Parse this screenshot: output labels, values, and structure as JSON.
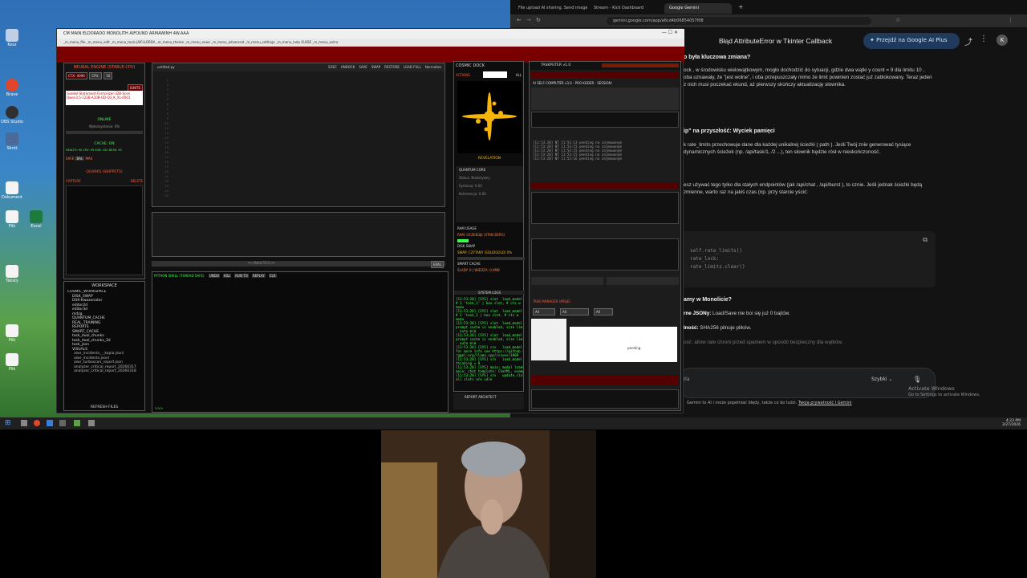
{
  "desktop": {
    "icons": [
      {
        "label": "Kosz",
        "color": "#bfcfe8"
      },
      {
        "label": "Brave",
        "color": "#e0462b"
      },
      {
        "label": "OBS Studio",
        "color": "#303030"
      },
      {
        "label": "Skrót",
        "color": "#4a6a9a"
      },
      {
        "label": "Dokument",
        "color": "#f4f4f4"
      },
      {
        "label": "Plik",
        "color": "#f4f4f4"
      },
      {
        "label": "Excel",
        "color": "#1d7a3e"
      },
      {
        "label": "Teksty",
        "color": "#f4f4f4"
      },
      {
        "label": "Plik",
        "color": "#f4f4f4"
      },
      {
        "label": "Plik",
        "color": "#f4f4f4"
      }
    ]
  },
  "chrome": {
    "tabs": [
      {
        "label": "File upload AI sharing. Send image an"
      },
      {
        "label": "Stream - Kick Dashboard"
      },
      {
        "label": "Google Gemini"
      }
    ],
    "url": "gemini.google.com/app/a6cd4b06854057f08"
  },
  "gemini": {
    "title": "Błąd AttributeError w Tkinter Callback",
    "plus_button": "Przejdź na Google AI Plus",
    "avatar": "K",
    "p1_head": "o była kluczowa zmiana?",
    "p1": "ock , w środowisku wielowątkowym, mogło dochodzić do sytuacji, gdzie dwa wątki y count = 9 dla limitu 10 , oba uznawały, że \"jest wolne\", i oba przepuszczały mimo że limit powinien zostać już zablokowany. Teraz jeden z nich musi poczekać ekund, aż pierwszy skończy aktualizację słownika.",
    "p2_head": "ip\" na przyszłość: Wyciek pamięci",
    "p2": "k rate_limits przechowuje dane dla każdej unikalnej ścieżki ( path ). Jeśli Twój znie generować tysiące dynamicznych ścieżek (np. /api/task/1, /2 ...), ten słownik będzie rósł w nieskończoność.",
    "p3": "esz używać tego tylko dla stałych endpointów (jak /api/chat , /api/burst ), to cznie. Jeśli jednak ścieżki będą zmienne, warto raz na jakiś czas (np. przy starcie yścić:",
    "code": [
      "self.rate_limits()",
      "rate_lock:",
      "rate_limits.clear()"
    ],
    "p4_head": "amy w Monolicie?",
    "p4a_bold": "rne JSONy:",
    "p4a": "Load/Save nie boi się już 0 bajtów.",
    "p4b_bold": "lność:",
    "p4b": "SHA256 pilnuje plików.",
    "p4c": "ość: allow rate chroni przed spamem w sposób bezpieczny dla wątków.",
    "input_placeholder": "zla",
    "speed_label": "Szybki",
    "disclaimer": "Gemini to AI i może popełniać błędy, także co do ludzi.",
    "disclaimer_link": "Twoja prywatność i Gemini",
    "activate_title": "Activate Windows",
    "activate_sub": "Go to Settings to activate Windows."
  },
  "app": {
    "title": "CM MAIN ELDORADO MONOLITH AIFOUND ARMAWINH 4W.AAA",
    "menu": "_m_menu_file  _m_menu_edit  _m_menu_tools  JAIFLLORDA  _m_menu_theme  _m_menu_news  _m_menu_advanced  _m_menu_settings  _m_menu_help  GUIDE  _m_menu_extra",
    "neural_title": "NEURAL ENGINE (STABLE-CPU)",
    "ctx_label": "CTX: 4096",
    "cpu_label": "CPU:",
    "cpu_value": "16",
    "ignite": "IGNITE",
    "model_name": "Goedel-Statement-Formalizer-32B-Scen Qwen3.5-122B-A10B-UD-Q3_K_XL-0001",
    "online": "ONLINE",
    "usage": "Wykorzystanie: 0%",
    "cache_on": "CACHE: ON",
    "cache_stats": "HEALTH: 90  CPU: 95  SUB: 100  DESK: 95",
    "safe": "SAFE",
    "bal": "BAL",
    "max": "MAX",
    "quarks_title": "QUARKS (SNIPPETS)",
    "capture": "CAPTURE",
    "delete": "DELETE",
    "workspace_title": "WORKSPACE",
    "tree": [
      "COSMIC_WORKSPACE",
      "DISK_SWAP",
      "DSR-Kwazonator",
      "editor2d",
      "editor3d",
      "mdzg",
      "QUANTUM_CACHE",
      "REAL_TRAINING",
      "REPORTS",
      "SMART_CACHE",
      "task_dual_chunks",
      "task_dual_chunks_3d",
      "task_json",
      "VISUALS",
      "aiwr_incidents_-_kopia.jsonl",
      "aiwr_incidents.jsonl",
      "aiwr_turboscan_report.json",
      "analyzer_critical_report_20260317",
      "analyzer_critical_report_20260318"
    ],
    "refresh_files": "REFRESH FILES",
    "editor_tab": "untitled.py",
    "editor_buttons": [
      "EXEC",
      "UNDOCK",
      "SAVE",
      "SWAP",
      "RESTORE",
      "LOAD FULL",
      "Normalize"
    ],
    "editor_lines": [
      "1",
      "2",
      "3",
      "4",
      "5",
      "6",
      "7",
      "8",
      "9",
      "10",
      "11",
      "12",
      "13",
      "14",
      "15",
      "16",
      "17",
      "18",
      "19",
      "20",
      "21",
      "22",
      "23",
      "24",
      "25"
    ],
    "shell_title": "PYTHON SHELL (THREAD SAFE)",
    "shell_buttons": [
      "UNDO",
      "KILL",
      "RUN TO",
      "REPLAY",
      "CLR"
    ],
    "shell_prompt": ">>>",
    "shell_divider": "━━ ANALYTICS ━━",
    "eval_button": "EVAL",
    "cosmic_dock": "COSMIC DOCK",
    "actions": "ACTIONS",
    "all": "ALL",
    "revelation": "REVELATION",
    "quantum_core": "QUANTUM CORE",
    "status": "Status: Nieaktywny",
    "synteza": "Syntezuj: 0.00",
    "koherencja": "Koherencja: 0.00",
    "ram_usage": "RAM USAGE",
    "ram_info": "RAM: OCZEKUJE (STAN ZERO)",
    "disk_swap": "DISK SWAP",
    "swap_info": "SWAP: CZYTANY (SOLIDGOLD) 0%",
    "smart_cache": "SMART CACHE",
    "slady": "ŚLADY: 0 | WIEDZA: 0.0MB",
    "system_logs": "SYSTEM LOGS",
    "logs": "[11:53:20] [SYS] slot  load_model\n# 1 'task_1' | box slot, # cts w\nmodu\n[11:53:20] [SYS] slot  load_model\n# 2 'task_1 | box slot, # cts w\nmodu\n[11:53:20] [SYS] slot  load_model\nprompt cache is enabled, size limit\n- auto mim\n[11:53:20] [SYS] slot  load_model\nprompt cache is enabled, size limit\n- auto mim\n[11:53:20] [SYS] srv   load_model\nfor more info see https://github.com\n/ggml-org/llama.cpp/issues/1008\n[11:53:20] [SYS] srv   load_model\nthinking = 0\n[11:53:20] [SYS] main: model loaded\nmain: chat_template: ChatML, example\n[11:53:20] [SYS] srv   update_slots\nall slots are idle",
    "report_architect": "REPORT ARCHITECT",
    "taskputer_title": "TASKPUTER v1.0",
    "ai_self": "AI SELF-COMPUTER v3.0 - PRO KODER - SESSION:",
    "task_logs": "[11:53:20] NT 11:53:13 pending na zajmowanym\n[11:53:20] NT 11:53:15 pending na zajmowanym\n[11:53:20] NT 11:53:15 pending na zajmowanym\n[11:53:20] NT 11:53:15 pending na zajmowanym\n[11:53:20] NT 11:53:16 pending na zajmowanym",
    "task_manager": "TASK MANAGER (MISJE)",
    "pending": "pending",
    "filter_all": "All"
  },
  "taskbar": {
    "time": "4:23 PM",
    "date": "3/27/2026"
  },
  "colors": {
    "accent": "#3cff4a",
    "alert": "#ff3c28",
    "gemini_bg": "#131314"
  }
}
